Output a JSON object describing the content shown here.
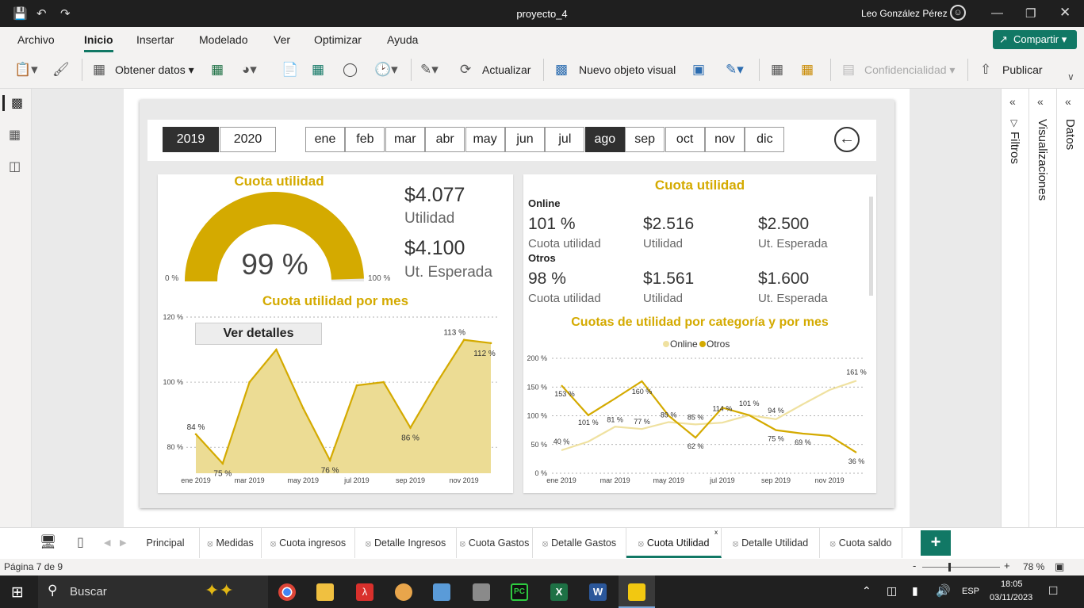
{
  "window": {
    "title": "proyecto_4",
    "user": "Leo González Pérez"
  },
  "menu": [
    "Archivo",
    "Inicio",
    "Insertar",
    "Modelado",
    "Ver",
    "Optimizar",
    "Ayuda"
  ],
  "share_label": "Compartir",
  "ribbon": {
    "get_data": "Obtener datos",
    "refresh": "Actualizar",
    "new_visual": "Nuevo objeto visual",
    "confidentiality": "Confidencialidad",
    "publish": "Publicar"
  },
  "slicer": {
    "years": [
      "2019",
      "2020"
    ],
    "selected_year": "2019",
    "months": [
      "ene",
      "feb",
      "mar",
      "abr",
      "may",
      "jun",
      "jul",
      "ago",
      "sep",
      "oct",
      "nov",
      "dic"
    ],
    "selected_month": "ago"
  },
  "left_card": {
    "gauge_title": "Cuota utilidad",
    "gauge_value": "99 %",
    "gauge_min": "0 %",
    "gauge_max": "100 %",
    "gauge_fraction": 0.99,
    "utilidad_value": "$4.077",
    "utilidad_label": "Utilidad",
    "esperada_value": "$4.100",
    "esperada_label": "Ut. Esperada",
    "area_title": "Cuota utilidad por mes",
    "details_button": "Ver detalles"
  },
  "right_card": {
    "title": "Cuota utilidad",
    "online": {
      "label": "Online",
      "cuota": "101 %",
      "cuota_label": "Cuota utilidad",
      "utilidad": "$2.516",
      "utilidad_label": "Utilidad",
      "esperada": "$2.500",
      "esperada_label": "Ut. Esperada"
    },
    "otros": {
      "label": "Otros",
      "cuota": "98 %",
      "cuota_label": "Cuota utilidad",
      "utilidad": "$1.561",
      "utilidad_label": "Utilidad",
      "esperada": "$1.600",
      "esperada_label": "Ut. Esperada"
    },
    "line_title": "Cuotas de utilidad por categoría y por mes"
  },
  "chart_data": [
    {
      "type": "area",
      "title": "Cuota utilidad por mes",
      "x": [
        "ene 2019",
        "feb 2019",
        "mar 2019",
        "abr 2019",
        "may 2019",
        "jun 2019",
        "jul 2019",
        "ago 2019",
        "sep 2019",
        "oct 2019",
        "nov 2019",
        "dic 2019"
      ],
      "x_tick_labels": [
        "ene 2019",
        "mar 2019",
        "may 2019",
        "jul 2019",
        "sep 2019",
        "nov 2019"
      ],
      "values": [
        84,
        75,
        100,
        110,
        92,
        76,
        99,
        100,
        86,
        100,
        113,
        112
      ],
      "data_labels": {
        "0": "84 %",
        "1": "75 %",
        "5": "76 %",
        "8": "86 %",
        "10": "113 %",
        "11": "112 %"
      },
      "y_ticks": [
        "120 %",
        "100 %",
        "80 %"
      ],
      "ylim": [
        72,
        120
      ],
      "color": "#d4aa00",
      "fill": "#ecdc94"
    },
    {
      "type": "line",
      "title": "Cuotas de utilidad por categoría y por mes",
      "x": [
        "ene 2019",
        "feb 2019",
        "mar 2019",
        "abr 2019",
        "may 2019",
        "jun 2019",
        "jul 2019",
        "ago 2019",
        "sep 2019",
        "oct 2019",
        "nov 2019",
        "dic 2019"
      ],
      "x_tick_labels": [
        "ene 2019",
        "mar 2019",
        "may 2019",
        "jul 2019",
        "sep 2019",
        "nov 2019"
      ],
      "series": [
        {
          "name": "Online",
          "color": "#efe1a0",
          "values": [
            40,
            55,
            81,
            77,
            89,
            85,
            88,
            101,
            94,
            120,
            145,
            161
          ]
        },
        {
          "name": "Otros",
          "color": "#d4aa00",
          "values": [
            153,
            101,
            130,
            160,
            100,
            62,
            114,
            101,
            75,
            69,
            65,
            36
          ]
        }
      ],
      "data_labels": [
        {
          "series": 0,
          "i": 0,
          "text": "40 %"
        },
        {
          "series": 0,
          "i": 2,
          "text": "81 %"
        },
        {
          "series": 0,
          "i": 3,
          "text": "77 %"
        },
        {
          "series": 0,
          "i": 4,
          "text": "89 %"
        },
        {
          "series": 0,
          "i": 5,
          "text": "85 %"
        },
        {
          "series": 0,
          "i": 7,
          "text": "101 %"
        },
        {
          "series": 0,
          "i": 8,
          "text": "94 %"
        },
        {
          "series": 0,
          "i": 11,
          "text": "161 %"
        },
        {
          "series": 1,
          "i": 0,
          "text": "153 %"
        },
        {
          "series": 1,
          "i": 1,
          "text": "101 %"
        },
        {
          "series": 1,
          "i": 3,
          "text": "160 %"
        },
        {
          "series": 1,
          "i": 5,
          "text": "62 %"
        },
        {
          "series": 1,
          "i": 6,
          "text": "114 %"
        },
        {
          "series": 1,
          "i": 8,
          "text": "75 %"
        },
        {
          "series": 1,
          "i": 9,
          "text": "69 %"
        },
        {
          "series": 1,
          "i": 11,
          "text": "36 %"
        }
      ],
      "y_ticks": [
        "200 %",
        "150 %",
        "100 %",
        "50 %",
        "0 %"
      ],
      "ylim": [
        0,
        200
      ],
      "legend": "top-center"
    }
  ],
  "panes": {
    "filters": "Filtros",
    "visualizations": "Visualizaciones",
    "data": "Datos"
  },
  "tabs": [
    {
      "label": "Principal",
      "hidden": false
    },
    {
      "label": "Medidas",
      "hidden": true
    },
    {
      "label": "Cuota ingresos",
      "hidden": true
    },
    {
      "label": "Detalle Ingresos",
      "hidden": true
    },
    {
      "label": "Cuota Gastos",
      "hidden": true
    },
    {
      "label": "Detalle Gastos",
      "hidden": true
    },
    {
      "label": "Cuota Utilidad",
      "hidden": true,
      "active": true
    },
    {
      "label": "Detalle Utilidad",
      "hidden": true
    },
    {
      "label": "Cuota saldo",
      "hidden": true
    }
  ],
  "add_tab": "+",
  "status": {
    "page": "Página 7 de 9",
    "zoom": "78 %"
  },
  "taskbar": {
    "search": "Buscar",
    "lang": "ESP",
    "time": "18:05",
    "date": "03/11/2023"
  }
}
